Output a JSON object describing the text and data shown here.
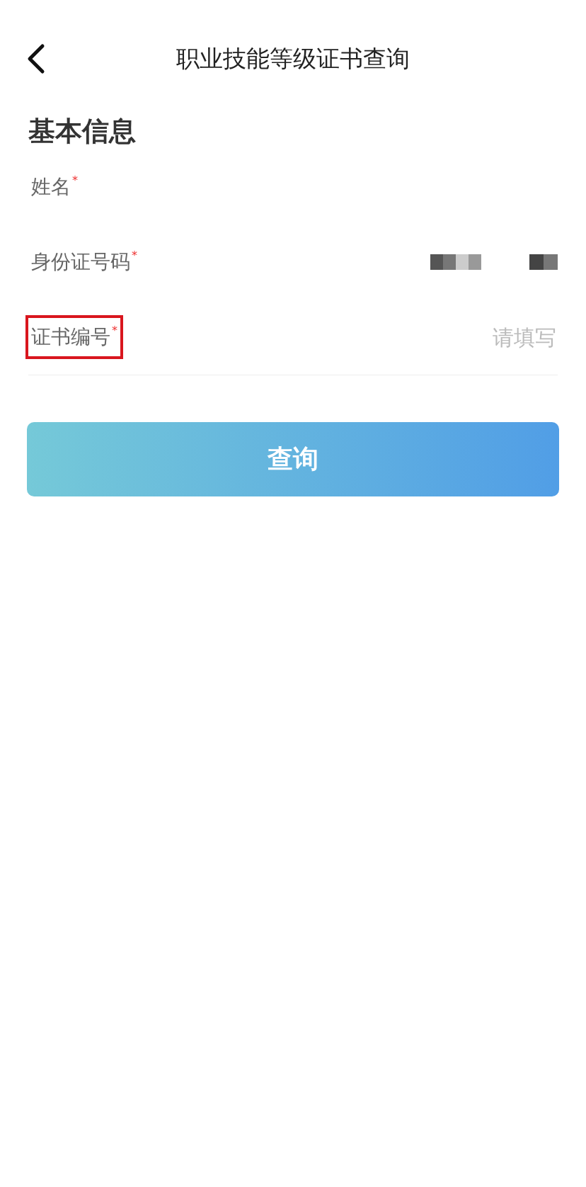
{
  "header": {
    "title": "职业技能等级证书查询"
  },
  "section": {
    "title": "基本信息"
  },
  "fields": [
    {
      "label": "姓名",
      "asterisk": "*",
      "kind": "blank",
      "highlighted": false
    },
    {
      "label": "身份证号码",
      "asterisk": "*",
      "kind": "pixelated",
      "highlighted": false
    },
    {
      "label": "证书编号",
      "asterisk": "*",
      "kind": "input",
      "placeholder": "请填写",
      "highlighted": true
    }
  ],
  "button": {
    "label": "查询"
  }
}
